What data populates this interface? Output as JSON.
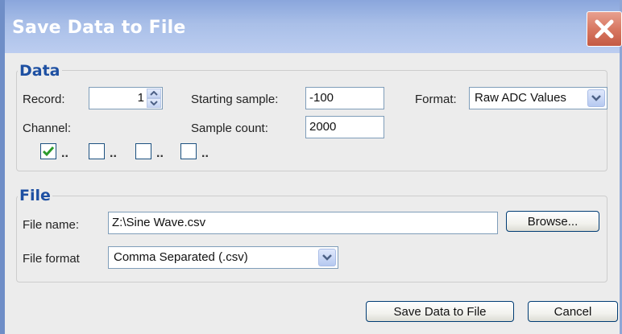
{
  "window": {
    "title": "Save Data to File",
    "close_icon": "close-icon"
  },
  "data_group": {
    "legend": "Data",
    "record_label": "Record:",
    "record_value": "1",
    "starting_sample_label": "Starting sample:",
    "starting_sample_value": "-100",
    "format_label": "Format:",
    "format_value": "Raw ADC Values",
    "channel_label": "Channel:",
    "sample_count_label": "Sample count:",
    "sample_count_value": "2000",
    "channels": [
      {
        "label": "..",
        "checked": true
      },
      {
        "label": "..",
        "checked": false
      },
      {
        "label": "..",
        "checked": false
      },
      {
        "label": "..",
        "checked": false
      }
    ]
  },
  "file_group": {
    "legend": "File",
    "file_name_label": "File name:",
    "file_name_value": "Z:\\Sine Wave.csv",
    "browse_label": "Browse...",
    "file_format_label": "File format",
    "file_format_value": "Comma Separated (.csv)"
  },
  "footer": {
    "save_label": "Save Data to File",
    "cancel_label": "Cancel"
  },
  "colors": {
    "legend": "#1e50a2",
    "titlebar": "#8aa6dc",
    "close": "#d87862",
    "check": "#2a9a2a"
  }
}
